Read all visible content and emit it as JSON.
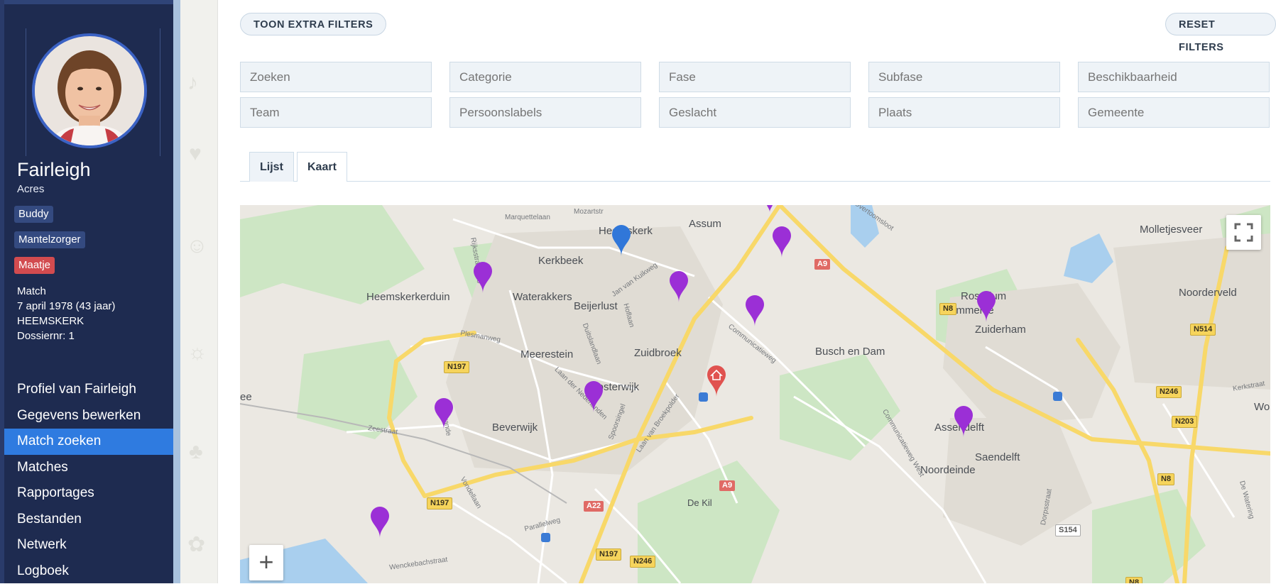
{
  "profile": {
    "first_name": "Fairleigh",
    "last_name": "Acres",
    "tags": [
      "Buddy",
      "Mantelzorger",
      "Maatje"
    ],
    "info": [
      "Match",
      "7 april 1978 (43 jaar)",
      "HEEMSKERK",
      "Dossiernr: 1"
    ]
  },
  "nav": {
    "items": [
      "Profiel van Fairleigh",
      "Gegevens bewerken",
      "Match zoeken",
      "Matches",
      "Rapportages",
      "Bestanden",
      "Netwerk",
      "Logboek"
    ],
    "active": "Match zoeken"
  },
  "toolbar": {
    "extra_filters": "TOON EXTRA FILTERS",
    "reset_filters": "RESET FILTERS"
  },
  "filters": [
    "Zoeken",
    "Categorie",
    "Fase",
    "Subfase",
    "Beschikbaarheid",
    "Team",
    "Persoonslabels",
    "Geslacht",
    "Plaats",
    "Gemeente"
  ],
  "tabs": {
    "list": "Lijst",
    "map": "Kaart",
    "active": "Kaart"
  },
  "map": {
    "places": [
      "Heemskerk",
      "Assum",
      "Molletjesveer",
      "Kerkbeek",
      "Heemskerkerduin",
      "Waterakkers",
      "Beijerlust",
      "Rosarium",
      "Krommenie",
      "Noorderveld",
      "Zuiderham",
      "Busch en Dam",
      "Meerestein",
      "Zuidbroek",
      "Oosterwijk",
      "Beverwijk",
      "Assendelft",
      "Saendelft",
      "Noordeinde",
      "De Kil",
      "ee",
      "Worr"
    ],
    "streets": [
      "Marquettelaan",
      "Mozartstr",
      "Rijksstraatweg",
      "Jan van Kuikweg",
      "Overtoomsloot",
      "Hoflaan",
      "Duitslandlaan",
      "Plesmanweg",
      "Communicatieweg",
      "Zeestraat",
      "Warande",
      "Laan der Nederlanden",
      "Spoorsingel",
      "Laan van Broekpolder",
      "Communicatieweg West",
      "Vondellaan",
      "Parallelweg",
      "Wenckebachstraat",
      "Dorpsstraat",
      "De Watering",
      "Kerkstraat"
    ],
    "roads": [
      "A9",
      "A9",
      "A22",
      "N8",
      "N8",
      "N8",
      "N197",
      "N197",
      "N197",
      "N246",
      "N246",
      "N203",
      "N514",
      "S154"
    ],
    "zoom_in": "+"
  },
  "colors": {
    "sidebar": "#1e2b50",
    "nav_active": "#2f7be0",
    "marker_purple": "#9b2fd6",
    "marker_blue": "#3077d9",
    "home_marker": "#e0524f"
  }
}
